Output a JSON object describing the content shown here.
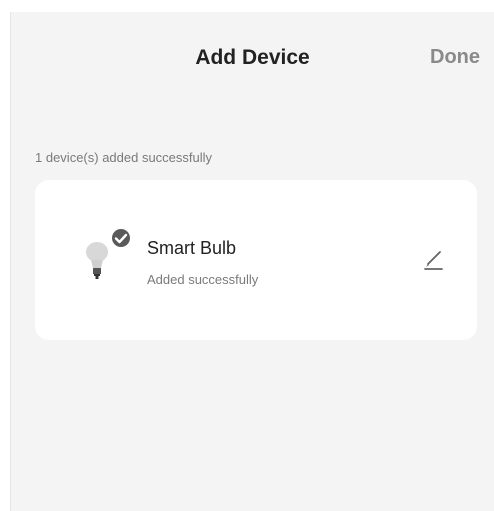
{
  "header": {
    "title": "Add Device",
    "done_label": "Done"
  },
  "summary": {
    "status_text": "1 device(s) added successfully"
  },
  "device": {
    "name": "Smart Bulb",
    "status": "Added successfully",
    "icon": "light-bulb-icon",
    "badge_icon": "checkmark-badge-icon"
  },
  "colors": {
    "screen_background": "#f4f4f4",
    "card_background": "#ffffff",
    "title": "#222222",
    "secondary_text": "#7a7a7a",
    "done": "#8a8a8a"
  }
}
